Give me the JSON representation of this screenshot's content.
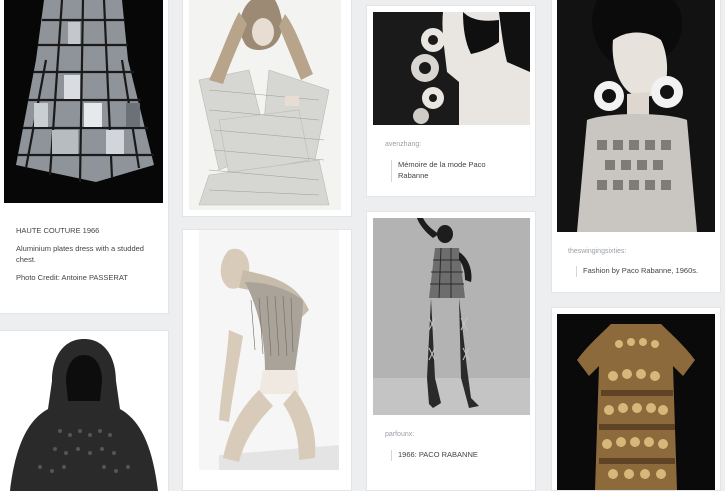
{
  "posts": [
    {
      "id": "haute-couture",
      "caption_title": "HAUTE COUTURE 1966",
      "caption_body": "Aluminium plates dress with a studded chest.",
      "caption_credit": "Photo Credit: Antoine PASSERAT"
    },
    {
      "id": "chain-hood"
    },
    {
      "id": "woven-sheets"
    },
    {
      "id": "kneeling-model"
    },
    {
      "id": "profile-earrings",
      "username": "avenzhang:",
      "quote": "Mémoire de la mode  Paco Rabanne"
    },
    {
      "id": "mini-dress-1966",
      "username": "parfounx:",
      "quote": "1966: PACO RABANNE"
    },
    {
      "id": "hoop-earrings",
      "username": "theswingingsixties:",
      "quote": "Fashion by Paco Rabanne, 1960s."
    },
    {
      "id": "gold-dress"
    }
  ],
  "colors": {
    "background": "#eceef0",
    "card": "#ffffff",
    "muted_text": "#9aa0a6",
    "body_text": "#444444",
    "gold": "#b8935a"
  }
}
